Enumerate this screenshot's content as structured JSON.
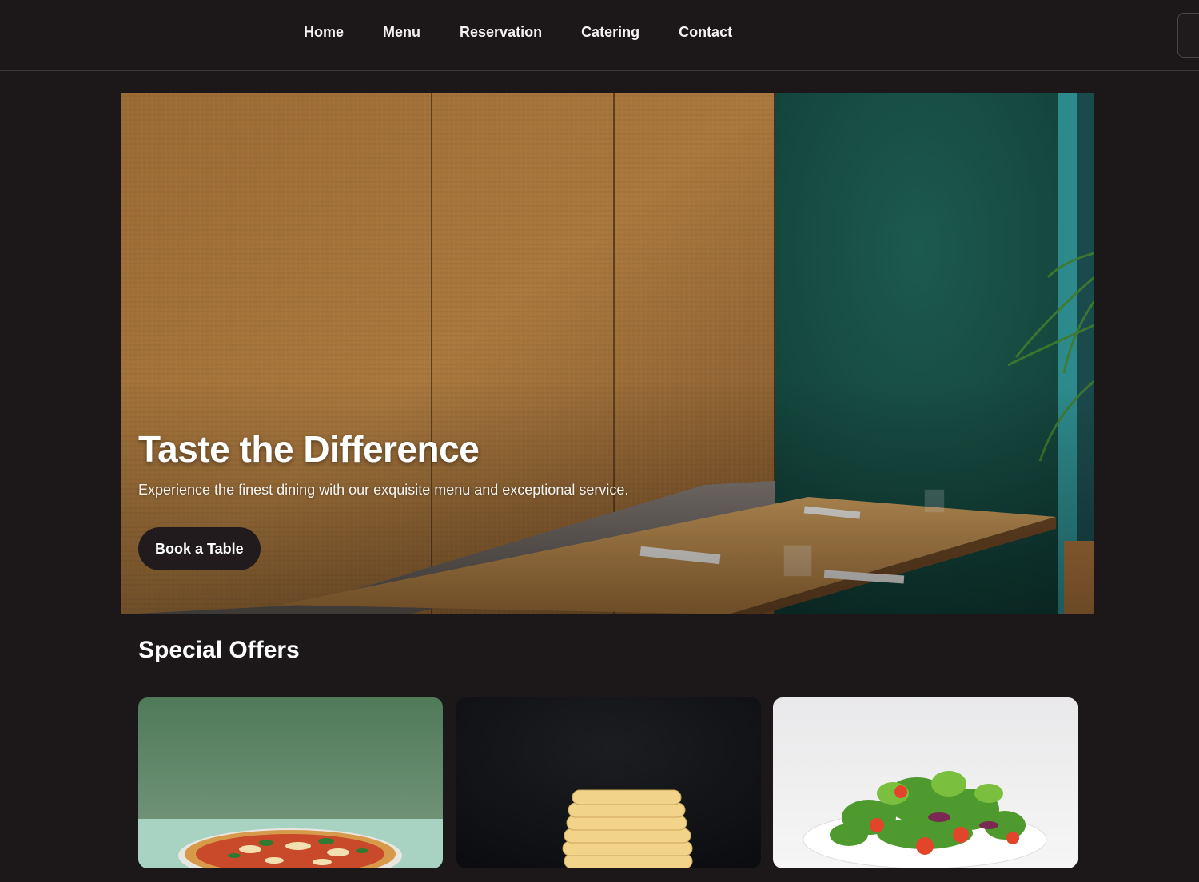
{
  "nav": {
    "items": [
      {
        "label": "Home"
      },
      {
        "label": "Menu"
      },
      {
        "label": "Reservation"
      },
      {
        "label": "Catering"
      },
      {
        "label": "Contact"
      }
    ]
  },
  "hero": {
    "title": "Taste the Difference",
    "subtitle": "Experience the finest dining with our exquisite menu and exceptional service.",
    "button_label": "Book a Table"
  },
  "offers": {
    "title": "Special Offers",
    "cards": [
      {
        "image": "pizza-image"
      },
      {
        "image": "pasta-image"
      },
      {
        "image": "salad-image"
      }
    ]
  },
  "colors": {
    "background": "#1c181a",
    "button": "#211b1d",
    "text": "#ffffff"
  }
}
